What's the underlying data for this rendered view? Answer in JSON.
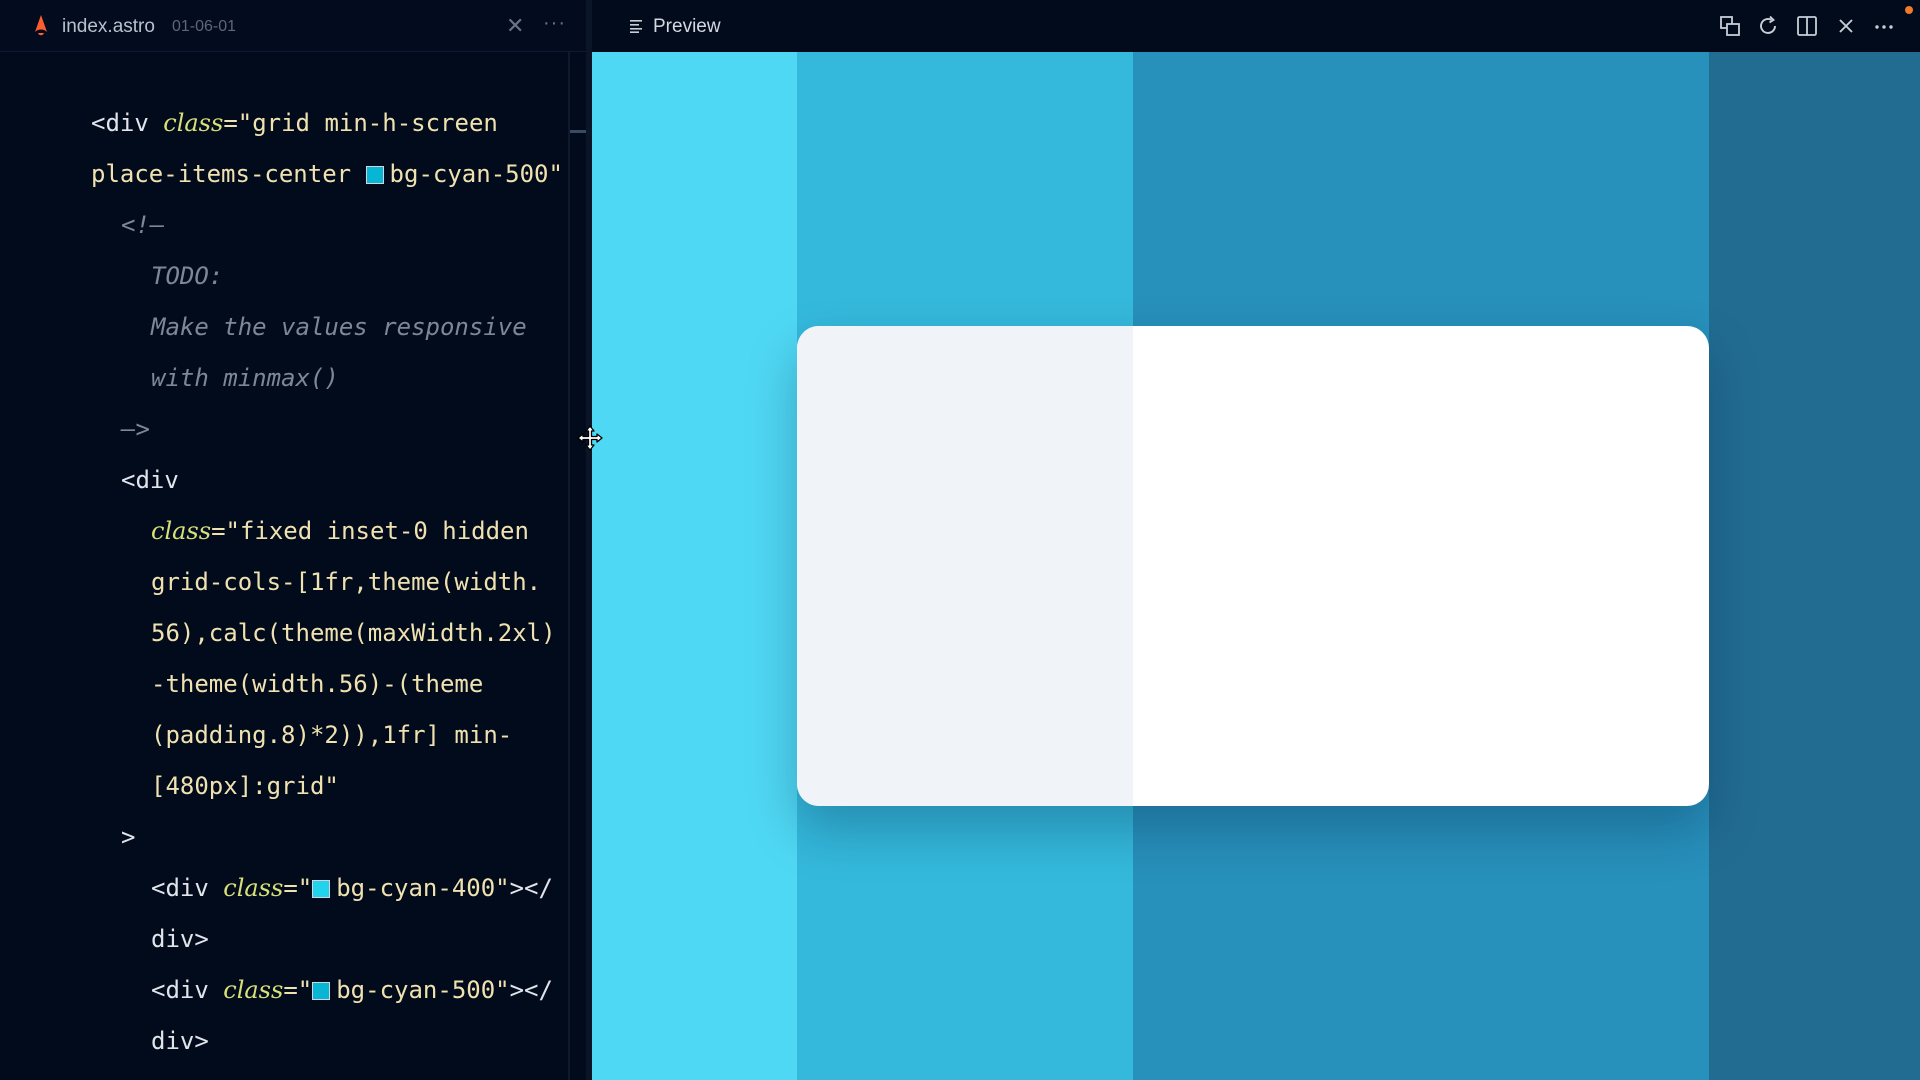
{
  "editor": {
    "tab": {
      "filename": "index.astro",
      "meta": "01-06-01"
    },
    "lines": [
      {
        "indent": 0,
        "tokens": [
          {
            "t": "<div ",
            "c": "tag"
          },
          {
            "t": "class",
            "c": "attr"
          },
          {
            "t": "=\"grid min-h-screen",
            "c": "str"
          }
        ]
      },
      {
        "indent": 0,
        "tokens": [
          {
            "t": "place-items-center ",
            "c": "str"
          },
          {
            "swatch": "#06b6d4"
          },
          {
            "t": "bg-cyan-500\"",
            "c": "str"
          }
        ]
      },
      {
        "indent": 1,
        "tokens": [
          {
            "t": "<!—",
            "c": "cmt"
          }
        ]
      },
      {
        "indent": 2,
        "tokens": [
          {
            "t": "TODO:",
            "c": "cmt"
          }
        ]
      },
      {
        "indent": 2,
        "tokens": [
          {
            "t": "Make the values responsive",
            "c": "cmt"
          }
        ]
      },
      {
        "indent": 2,
        "tokens": [
          {
            "t": "with minmax()",
            "c": "cmt"
          }
        ]
      },
      {
        "indent": 1,
        "tokens": [
          {
            "t": "—>",
            "c": "cmt"
          }
        ]
      },
      {
        "indent": 1,
        "tokens": [
          {
            "t": "<div",
            "c": "tag"
          }
        ]
      },
      {
        "indent": 2,
        "tokens": [
          {
            "t": "class",
            "c": "attr"
          },
          {
            "t": "=\"fixed inset-0 hidden",
            "c": "str"
          }
        ]
      },
      {
        "indent": 2,
        "tokens": [
          {
            "t": "grid-cols-[1fr,theme(width.",
            "c": "str"
          }
        ]
      },
      {
        "indent": 2,
        "tokens": [
          {
            "t": "56),calc(theme(maxWidth.2xl)",
            "c": "str"
          }
        ]
      },
      {
        "indent": 2,
        "tokens": [
          {
            "t": "-theme(width.56)-(theme",
            "c": "str"
          }
        ]
      },
      {
        "indent": 2,
        "tokens": [
          {
            "t": "(padding.8)*2)),1fr] min-",
            "c": "str"
          }
        ]
      },
      {
        "indent": 2,
        "tokens": [
          {
            "t": "[480px]:grid\"",
            "c": "str"
          }
        ]
      },
      {
        "indent": 1,
        "tokens": [
          {
            "t": ">",
            "c": "tag"
          }
        ]
      },
      {
        "indent": 2,
        "tokens": [
          {
            "t": "<div ",
            "c": "tag"
          },
          {
            "t": "class",
            "c": "attr"
          },
          {
            "t": "=\"",
            "c": "str"
          },
          {
            "swatch": "#22d3ee"
          },
          {
            "t": "bg-cyan-400\"",
            "c": "str"
          },
          {
            "t": "></",
            "c": "tag"
          }
        ]
      },
      {
        "indent": 2,
        "tokens": [
          {
            "t": "div>",
            "c": "tag"
          }
        ]
      },
      {
        "indent": 2,
        "tokens": [
          {
            "t": "<div ",
            "c": "tag"
          },
          {
            "t": "class",
            "c": "attr"
          },
          {
            "t": "=\"",
            "c": "str"
          },
          {
            "swatch": "#06b6d4"
          },
          {
            "t": "bg-cyan-500\"",
            "c": "str"
          },
          {
            "t": "></",
            "c": "tag"
          }
        ]
      },
      {
        "indent": 2,
        "tokens": [
          {
            "t": "div>",
            "c": "tag"
          }
        ]
      }
    ]
  },
  "preview": {
    "title": "Preview",
    "toolbar_icons": [
      "open-external-icon",
      "refresh-icon",
      "split-view-icon",
      "close-icon",
      "more-icon"
    ],
    "colors": {
      "cyan_400": "#4fd8f4",
      "cyan_500": "#34b9dc",
      "cyan_600": "#2790bb",
      "cyan_700": "#226c92",
      "card": "#ffffff",
      "card_sidebar": "#f0f4f9",
      "notification_dot": "#f07a2a"
    }
  }
}
